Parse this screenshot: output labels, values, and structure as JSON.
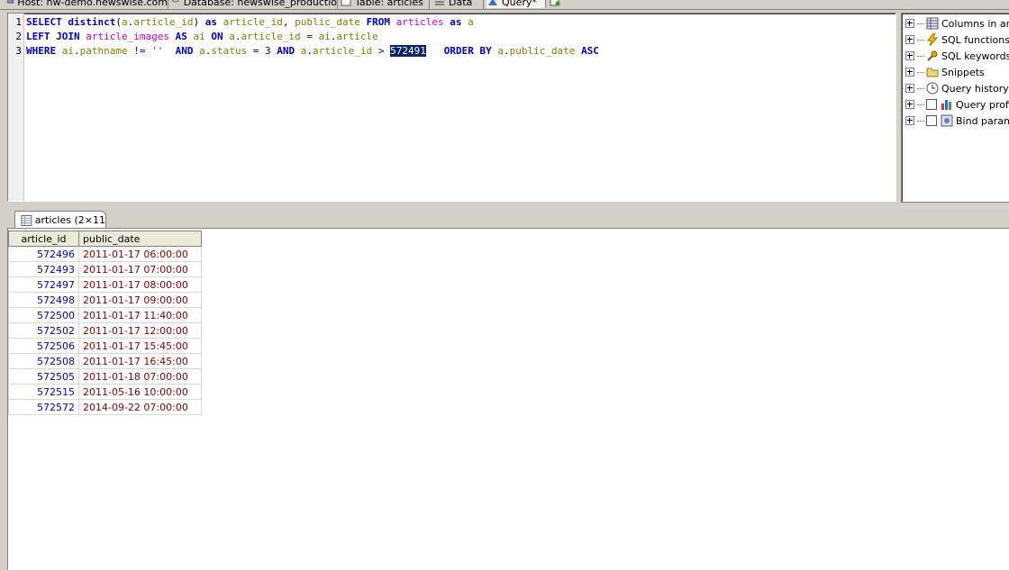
{
  "tabs": [
    {
      "label": "Host: nw-demo.newswise.com",
      "icon": "host-icon"
    },
    {
      "label": "Database: newswise_productio",
      "icon": "database-icon"
    },
    {
      "label": "Table: articles",
      "icon": "table-icon"
    },
    {
      "label": "Data",
      "icon": "data-icon"
    },
    {
      "label": "Query*",
      "icon": "query-icon"
    }
  ],
  "editor": {
    "line_numbers": [
      "1",
      "2",
      "3"
    ]
  },
  "side_panel": {
    "items": [
      {
        "label": "Columns in artic",
        "icon": "columns-icon"
      },
      {
        "label": "SQL functions",
        "icon": "lightning-icon"
      },
      {
        "label": "SQL keywords",
        "icon": "key-icon"
      },
      {
        "label": "Snippets",
        "icon": "folder-icon"
      },
      {
        "label": "Query history",
        "icon": "clock-icon"
      },
      {
        "label": "Query profil",
        "icon": "chart-icon"
      },
      {
        "label": "Bind param",
        "icon": "parameter-icon"
      }
    ]
  },
  "results": {
    "tab_label": "articles (2×11",
    "columns": [
      "article_id",
      "public_date"
    ],
    "rows": [
      [
        "572496",
        "2011-01-17 06:00:00"
      ],
      [
        "572493",
        "2011-01-17 07:00:00"
      ],
      [
        "572497",
        "2011-01-17 08:00:00"
      ],
      [
        "572498",
        "2011-01-17 09:00:00"
      ],
      [
        "572500",
        "2011-01-17 11:40:00"
      ],
      [
        "572502",
        "2011-01-17 12:00:00"
      ],
      [
        "572506",
        "2011-01-17 15:45:00"
      ],
      [
        "572508",
        "2011-01-17 16:45:00"
      ],
      [
        "572505",
        "2011-01-18 07:00:00"
      ],
      [
        "572515",
        "2011-05-16 10:00:00"
      ],
      [
        "572572",
        "2014-09-22 07:00:00"
      ]
    ]
  },
  "colors": {
    "keyword": "#0000cc",
    "table_name": "#cc00cc",
    "identifier": "#808000",
    "selection": "#0a246a",
    "id_cell": "#0000cc",
    "date_cell": "#8b0000"
  }
}
